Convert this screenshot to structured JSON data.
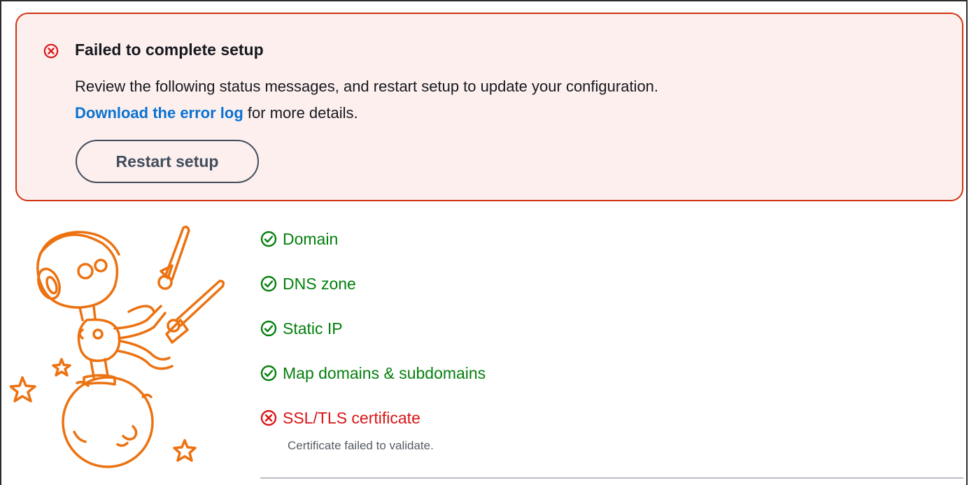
{
  "alert": {
    "icon": "error-circle-icon",
    "title": "Failed to complete setup",
    "message": "Review the following status messages, and restart setup to update your configuration.",
    "link_text": "Download the error log",
    "link_suffix": " for more details.",
    "button_label": "Restart setup",
    "color": "#d13212",
    "background": "#fcefee"
  },
  "illustration": "robot-on-planet-illustration",
  "steps": [
    {
      "label": "Domain",
      "status": "success",
      "icon": "check-circle-icon"
    },
    {
      "label": "DNS zone",
      "status": "success",
      "icon": "check-circle-icon"
    },
    {
      "label": "Static IP",
      "status": "success",
      "icon": "check-circle-icon"
    },
    {
      "label": "Map domains & subdomains",
      "status": "success",
      "icon": "check-circle-icon"
    },
    {
      "label": "SSL/TLS certificate",
      "status": "error",
      "icon": "error-circle-icon",
      "detail": "Certificate failed to validate."
    }
  ],
  "colors": {
    "success": "#037f0c",
    "error": "#d91515",
    "link": "#0972d3",
    "illustration": "#ec7211"
  }
}
